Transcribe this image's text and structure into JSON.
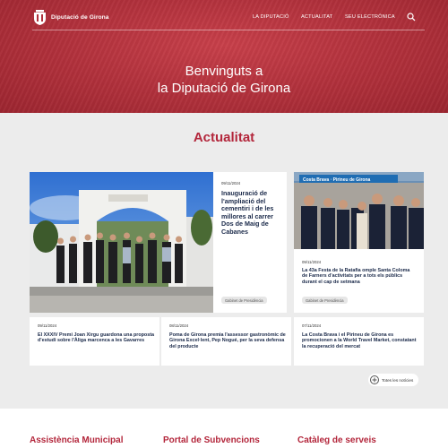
{
  "header": {
    "logo_text": "Diputació de Girona",
    "nav": [
      "LA DIPUTACIÓ",
      "ACTUALITAT",
      "SEU ELECTRÒNICA"
    ],
    "hero_line1": "Benvinguts a",
    "hero_line2": "la Diputació de Girona"
  },
  "news_section": {
    "title": "Actualitat",
    "all_news_label": "Totes les notícies",
    "featured": {
      "date": "09/11/2024",
      "headline": "Inauguració de l'ampliació del cementiri i de les millores al carrer Dos de Maig de Cabanes",
      "tag": "Gabinet de Presidència"
    },
    "side": {
      "sign_text": "Costa Brava · Pirineu de Girona",
      "date": "09/11/2024",
      "headline": "La 43a Festa de la Ratafia omple Santa Coloma de Farners d'activitats per a tots els públics durant el cap de setmana",
      "tag": "Gabinet de Presidència"
    },
    "row": [
      {
        "date": "09/11/2024",
        "headline": "El XXXIV Premi Joan Xirgu guardona una proposta d'estudi sobre l'Àliga marcenca a les Gavarres"
      },
      {
        "date": "08/11/2024",
        "headline": "Poma de Girona premia l'assessor gastronòmic de Girona Excel·lent, Pep Nogué, per la seva defensa del producte"
      },
      {
        "date": "07/11/2024",
        "headline": "La Costa Brava i el Pirineu de Girona es promocionen a la World Travel Market, constatant la recuperació del mercat"
      }
    ]
  },
  "bottom_sections": [
    "Assistència Municipal",
    "Portal de Subvencions",
    "Catàleg de serveis"
  ],
  "colors": {
    "brand_red": "#b3263b",
    "hero_red": "#b0303b",
    "headline_navy": "#1b2a4a"
  }
}
